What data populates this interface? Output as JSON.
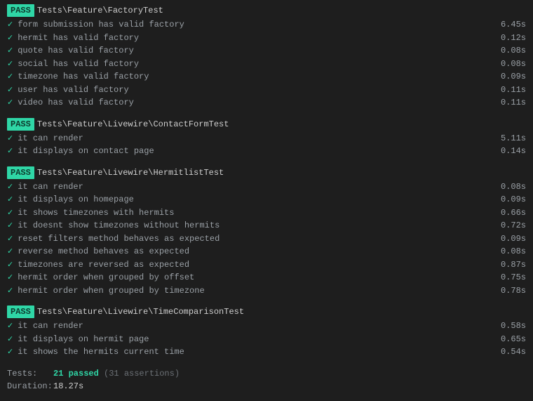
{
  "badge_label": "PASS",
  "checkmark": "✓",
  "groups": [
    {
      "path": "Tests\\Feature\\FactoryTest",
      "tests": [
        {
          "name": "form submission has valid factory",
          "time": "6.45s"
        },
        {
          "name": "hermit has valid factory",
          "time": "0.12s"
        },
        {
          "name": "quote has valid factory",
          "time": "0.08s"
        },
        {
          "name": "social has valid factory",
          "time": "0.08s"
        },
        {
          "name": "timezone has valid factory",
          "time": "0.09s"
        },
        {
          "name": "user has valid factory",
          "time": "0.11s"
        },
        {
          "name": "video has valid factory",
          "time": "0.11s"
        }
      ]
    },
    {
      "path": "Tests\\Feature\\Livewire\\ContactFormTest",
      "tests": [
        {
          "name": "it can render",
          "time": "5.11s"
        },
        {
          "name": "it displays on contact page",
          "time": "0.14s"
        }
      ]
    },
    {
      "path": "Tests\\Feature\\Livewire\\HermitlistTest",
      "tests": [
        {
          "name": "it can render",
          "time": "0.08s"
        },
        {
          "name": "it displays on homepage",
          "time": "0.09s"
        },
        {
          "name": "it shows timezones with hermits",
          "time": "0.66s"
        },
        {
          "name": "it doesnt show timezones without hermits",
          "time": "0.72s"
        },
        {
          "name": "reset filters method behaves as expected",
          "time": "0.09s"
        },
        {
          "name": "reverse method behaves as expected",
          "time": "0.08s"
        },
        {
          "name": "timezones are reversed as expected",
          "time": "0.87s"
        },
        {
          "name": "hermit order when grouped by offset",
          "time": "0.75s"
        },
        {
          "name": "hermit order when grouped by timezone",
          "time": "0.78s"
        }
      ]
    },
    {
      "path": "Tests\\Feature\\Livewire\\TimeComparisonTest",
      "tests": [
        {
          "name": "it can render",
          "time": "0.58s"
        },
        {
          "name": "it displays on hermit page",
          "time": "0.65s"
        },
        {
          "name": "it shows the hermits current time",
          "time": "0.54s"
        }
      ]
    }
  ],
  "summary": {
    "tests_label": "Tests:",
    "passed": "21 passed",
    "assertions": "(31 assertions)",
    "duration_label": "Duration:",
    "duration_value": "18.27s"
  }
}
